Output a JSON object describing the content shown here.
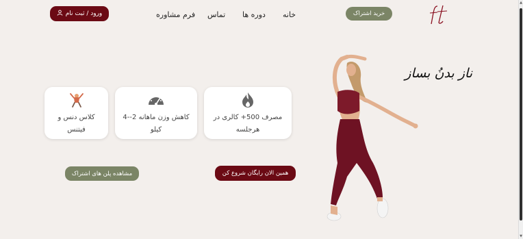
{
  "header": {
    "login_label": "ورود / ثبت نام",
    "user_icon": "user-icon",
    "nav": [
      {
        "label": "فرم مشاوره"
      },
      {
        "label": "تماس"
      },
      {
        "label": "دوره ها"
      },
      {
        "label": "خانه"
      }
    ],
    "subscribe_label": "خرید اشتراک",
    "logo_text": "ft"
  },
  "hero": {
    "title": "ناز بدنُ بساز",
    "start_button": "همین الان رایگان شروع کن",
    "plans_button": "مشاهده پلن های اشتراک"
  },
  "cards": [
    {
      "icon": "flame-icon",
      "text_line1": "مصرف 500+ کالری در",
      "text_line2": "هرجلسه"
    },
    {
      "icon": "speedometer-icon",
      "text_line1": "کاهش وزن ماهانه 2--4",
      "text_line2": "کیلو"
    },
    {
      "icon": "dance-fitness-icon",
      "text_line1": "کلاس دنس و",
      "text_line2": "فیتنس"
    }
  ],
  "colors": {
    "background": "#f3efec",
    "primary": "#6b0a14",
    "secondary": "#7b8566"
  }
}
